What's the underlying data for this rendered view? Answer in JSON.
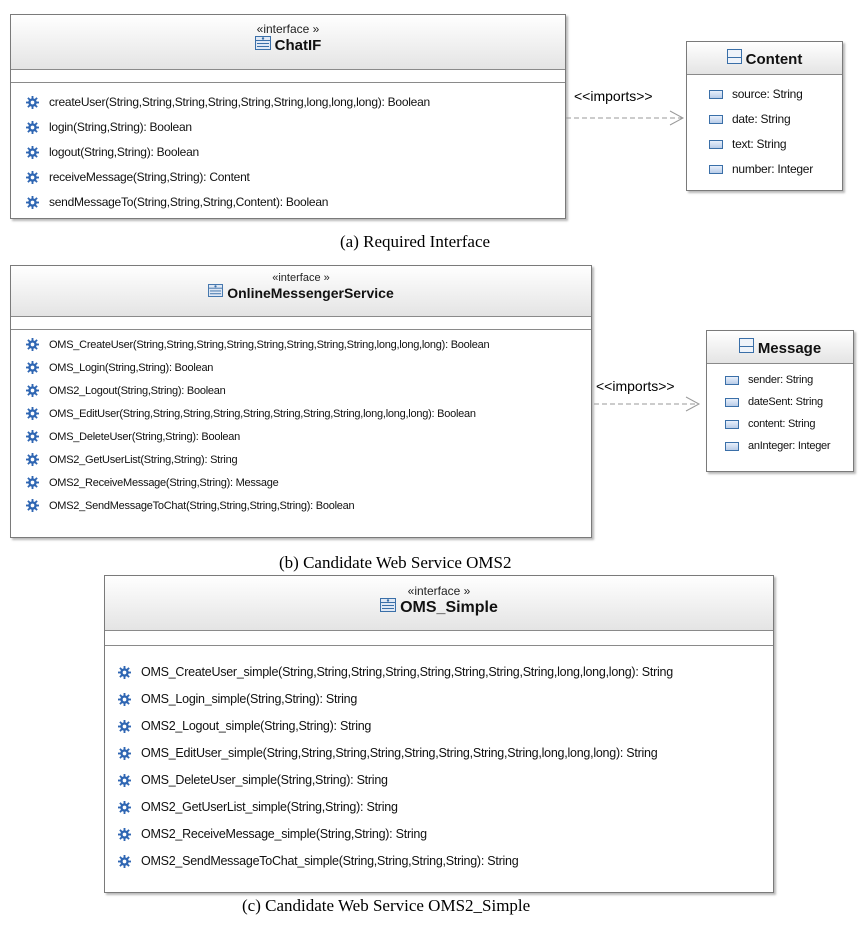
{
  "chatif": {
    "stereotype": "«interface »",
    "name": "ChatIF",
    "methods": [
      "createUser(String,String,String,String,String,String,long,long,long): Boolean",
      "login(String,String): Boolean",
      "logout(String,String): Boolean",
      "receiveMessage(String,String): Content",
      "sendMessageTo(String,String,String,Content): Boolean"
    ]
  },
  "content": {
    "name": "Content",
    "fields": [
      "source: String",
      "date: String",
      "text: String",
      "number: Integer"
    ]
  },
  "imports_a": "<<imports>>",
  "caption_a": "(a) Required Interface",
  "oms2": {
    "stereotype": "«interface »",
    "name": "OnlineMessengerService",
    "methods": [
      "OMS_CreateUser(String,String,String,String,String,String,String,String,long,long,long): Boolean",
      "OMS_Login(String,String): Boolean",
      "OMS2_Logout(String,String): Boolean",
      "OMS_EditUser(String,String,String,String,String,String,String,String,long,long,long): Boolean",
      "OMS_DeleteUser(String,String): Boolean",
      "OMS2_GetUserList(String,String): String",
      "OMS2_ReceiveMessage(String,String): Message",
      "OMS2_SendMessageToChat(String,String,String,String): Boolean"
    ]
  },
  "message": {
    "name": "Message",
    "fields": [
      "sender: String",
      "dateSent: String",
      "content: String",
      "anInteger: Integer"
    ]
  },
  "imports_b": "<<imports>>",
  "caption_b": "(b) Candidate Web Service OMS2",
  "simple": {
    "stereotype": "«interface »",
    "name": "OMS_Simple",
    "methods": [
      "OMS_CreateUser_simple(String,String,String,String,String,String,String,String,long,long,long): String",
      "OMS_Login_simple(String,String): String",
      "OMS2_Logout_simple(String,String): String",
      "OMS_EditUser_simple(String,String,String,String,String,String,String,String,long,long,long): String",
      "OMS_DeleteUser_simple(String,String): String",
      "OMS2_GetUserList_simple(String,String): String",
      "OMS2_ReceiveMessage_simple(String,String): String",
      "OMS2_SendMessageToChat_simple(String,String,String,String): String"
    ]
  },
  "caption_c": "(c) Candidate Web Service OMS2_Simple"
}
